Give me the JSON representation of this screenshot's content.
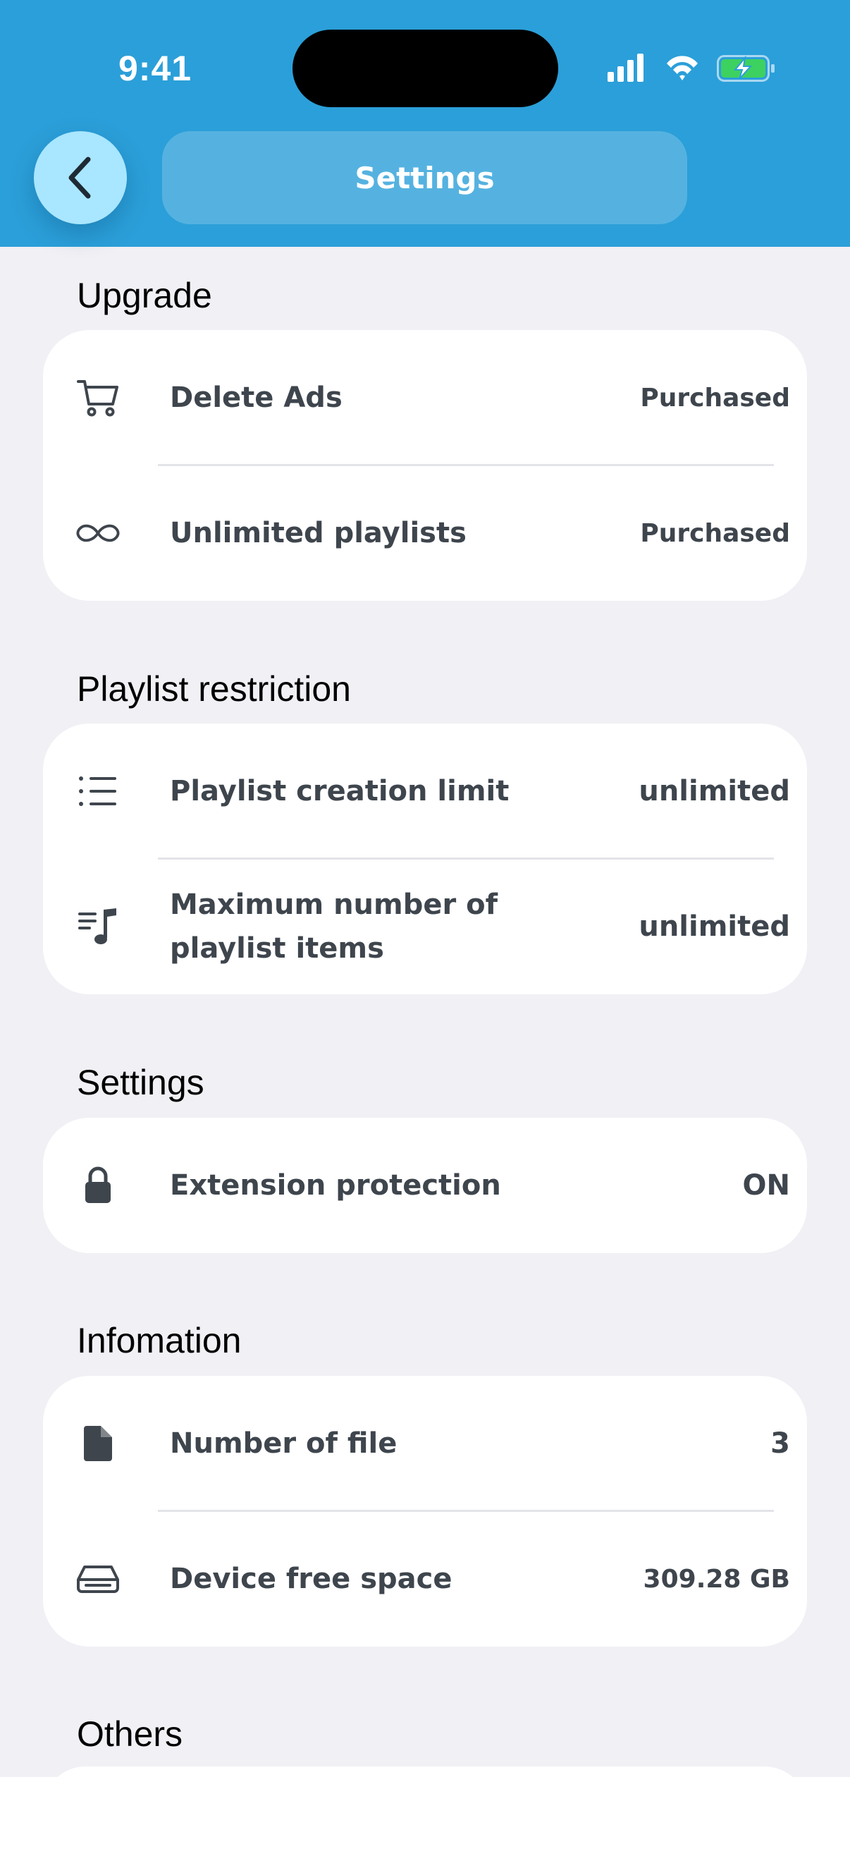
{
  "status_bar": {
    "time": "9:41",
    "icons": [
      "signal-icon",
      "wifi-icon",
      "battery-charging-icon"
    ]
  },
  "header": {
    "title": "Settings",
    "back_icon": "chevron-left-icon"
  },
  "colors": {
    "header_bg": "#2B9FD9",
    "back_button_bg": "#A9E6FF",
    "page_bg": "#F0F0F5",
    "card_bg": "#FFFFFF",
    "text": "#3E454D",
    "battery_fill": "#3DD15F"
  },
  "sections": {
    "upgrade": {
      "title": "Upgrade",
      "items": [
        {
          "icon": "cart-icon",
          "label": "Delete Ads",
          "value": "Purchased"
        },
        {
          "icon": "infinity-icon",
          "label": "Unlimited playlists",
          "value": "Purchased"
        }
      ]
    },
    "playlist": {
      "title": "Playlist restriction",
      "items": [
        {
          "icon": "list-icon",
          "label": "Playlist creation limit",
          "value": "unlimited"
        },
        {
          "icon": "music-list-icon",
          "label": "Maximum number of playlist items",
          "value": "unlimited"
        }
      ]
    },
    "settings": {
      "title": "Settings",
      "items": [
        {
          "icon": "lock-icon",
          "label": "Extension protection",
          "value": "ON"
        }
      ]
    },
    "info": {
      "title": "Infomation",
      "items": [
        {
          "icon": "file-icon",
          "label": "Number of file",
          "value": "3"
        },
        {
          "icon": "drive-icon",
          "label": "Device free space",
          "value": "309.28 GB"
        }
      ]
    },
    "others": {
      "title": "Others"
    }
  }
}
